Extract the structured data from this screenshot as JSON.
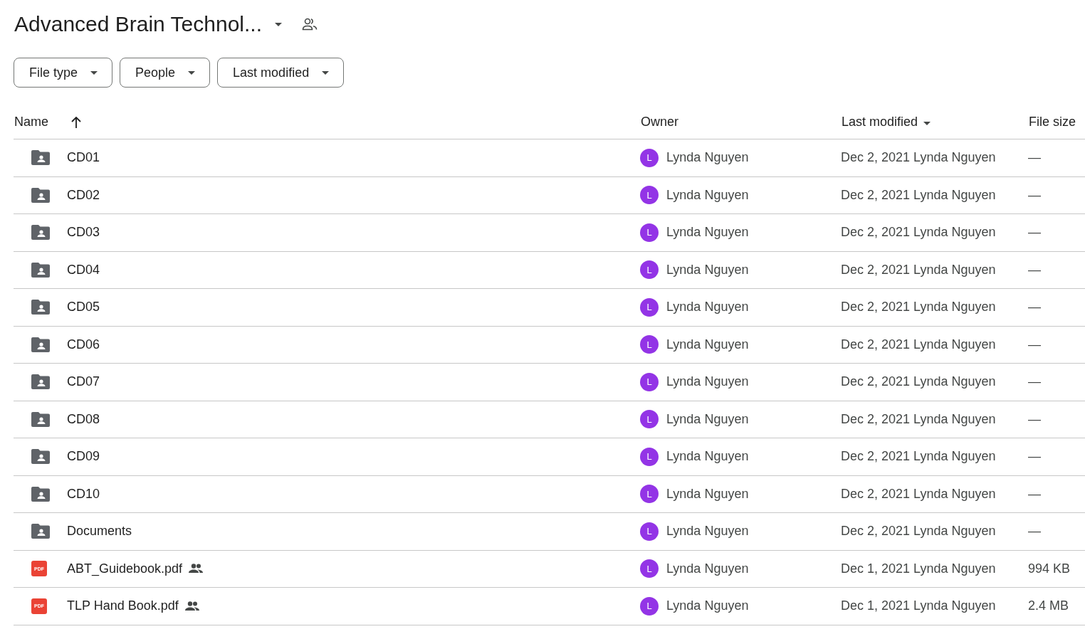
{
  "title": "Advanced Brain Technol...",
  "filters": [
    "File type",
    "People",
    "Last modified"
  ],
  "columns": [
    {
      "label": "Name",
      "kind": "arrow"
    },
    {
      "label": "Owner",
      "kind": "plain"
    },
    {
      "label": "Last modified",
      "kind": "caret"
    },
    {
      "label": "File size",
      "kind": "plain"
    }
  ],
  "rows": [
    {
      "kind": "folder",
      "name": "CD01",
      "shared": false,
      "avatar": "L",
      "owner": "Lynda Nguyen",
      "modified": "Dec 2, 2021 Lynda Nguyen",
      "size": "—"
    },
    {
      "kind": "folder",
      "name": "CD02",
      "shared": false,
      "avatar": "L",
      "owner": "Lynda Nguyen",
      "modified": "Dec 2, 2021 Lynda Nguyen",
      "size": "—"
    },
    {
      "kind": "folder",
      "name": "CD03",
      "shared": false,
      "avatar": "L",
      "owner": "Lynda Nguyen",
      "modified": "Dec 2, 2021 Lynda Nguyen",
      "size": "—"
    },
    {
      "kind": "folder",
      "name": "CD04",
      "shared": false,
      "avatar": "L",
      "owner": "Lynda Nguyen",
      "modified": "Dec 2, 2021 Lynda Nguyen",
      "size": "—"
    },
    {
      "kind": "folder",
      "name": "CD05",
      "shared": false,
      "avatar": "L",
      "owner": "Lynda Nguyen",
      "modified": "Dec 2, 2021 Lynda Nguyen",
      "size": "—"
    },
    {
      "kind": "folder",
      "name": "CD06",
      "shared": false,
      "avatar": "L",
      "owner": "Lynda Nguyen",
      "modified": "Dec 2, 2021 Lynda Nguyen",
      "size": "—"
    },
    {
      "kind": "folder",
      "name": "CD07",
      "shared": false,
      "avatar": "L",
      "owner": "Lynda Nguyen",
      "modified": "Dec 2, 2021 Lynda Nguyen",
      "size": "—"
    },
    {
      "kind": "folder",
      "name": "CD08",
      "shared": false,
      "avatar": "L",
      "owner": "Lynda Nguyen",
      "modified": "Dec 2, 2021 Lynda Nguyen",
      "size": "—"
    },
    {
      "kind": "folder",
      "name": "CD09",
      "shared": false,
      "avatar": "L",
      "owner": "Lynda Nguyen",
      "modified": "Dec 2, 2021 Lynda Nguyen",
      "size": "—"
    },
    {
      "kind": "folder",
      "name": "CD10",
      "shared": false,
      "avatar": "L",
      "owner": "Lynda Nguyen",
      "modified": "Dec 2, 2021 Lynda Nguyen",
      "size": "—"
    },
    {
      "kind": "folder",
      "name": "Documents",
      "shared": false,
      "avatar": "L",
      "owner": "Lynda Nguyen",
      "modified": "Dec 2, 2021 Lynda Nguyen",
      "size": "—"
    },
    {
      "kind": "pdf",
      "badge": "PDF",
      "name": "ABT_Guidebook.pdf",
      "shared": true,
      "avatar": "L",
      "owner": "Lynda Nguyen",
      "modified": "Dec 1, 2021 Lynda Nguyen",
      "size": "994 KB"
    },
    {
      "kind": "pdf",
      "badge": "PDF",
      "name": "TLP Hand Book.pdf",
      "shared": true,
      "avatar": "L",
      "owner": "Lynda Nguyen",
      "modified": "Dec 1, 2021 Lynda Nguyen",
      "size": "2.4 MB"
    }
  ]
}
